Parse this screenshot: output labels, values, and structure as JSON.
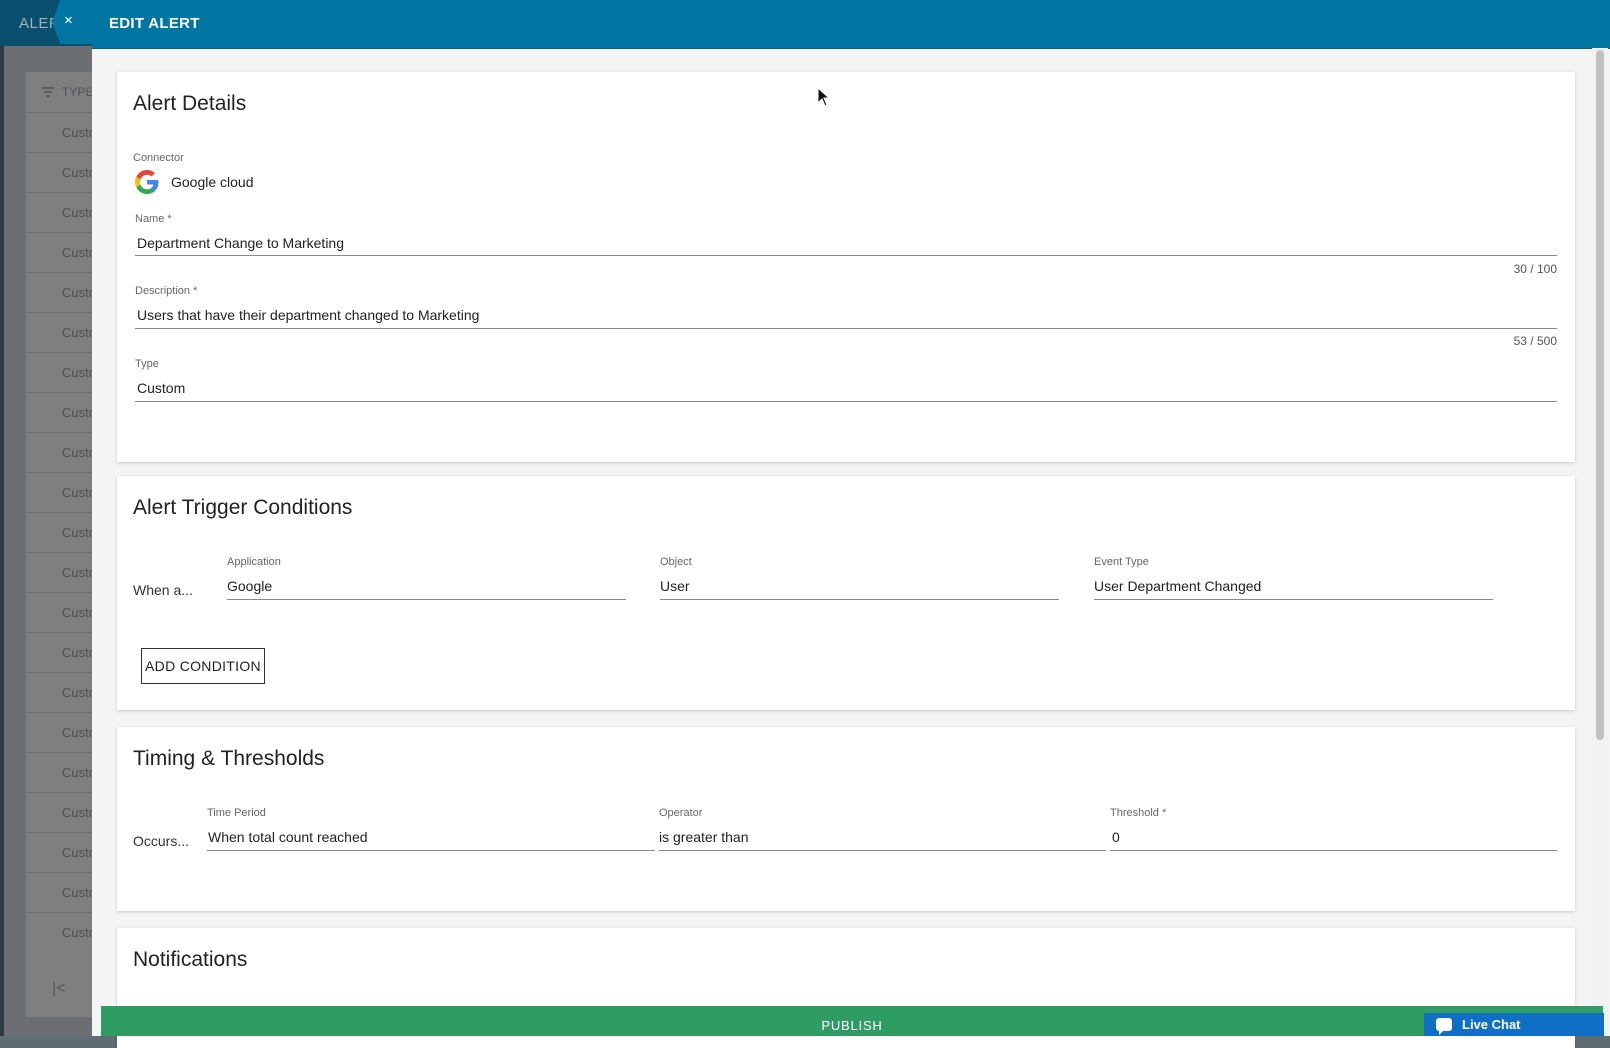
{
  "background": {
    "page_title": "ALER",
    "filter_header": "TYPE",
    "row_text": "Custo",
    "row_count": 21
  },
  "panel": {
    "title": "EDIT ALERT",
    "close_label": "×"
  },
  "alert_details": {
    "title": "Alert Details",
    "connector_label": "Connector",
    "connector_value": "Google cloud",
    "name_label": "Name *",
    "name_value": "Department Change to Marketing",
    "name_counter": "30 / 100",
    "description_label": "Description *",
    "description_value": "Users that have their department changed to Marketing",
    "description_counter": "53 / 500",
    "type_label": "Type",
    "type_value": "Custom"
  },
  "trigger": {
    "title": "Alert Trigger Conditions",
    "row_label": "When a...",
    "application_label": "Application",
    "application_value": "Google",
    "object_label": "Object",
    "object_value": "User",
    "event_label": "Event Type",
    "event_value": "User Department Changed",
    "add_condition": "ADD CONDITION"
  },
  "timing": {
    "title": "Timing & Thresholds",
    "row_label": "Occurs...",
    "period_label": "Time Period",
    "period_value": "When total count reached",
    "operator_label": "Operator",
    "operator_value": "is greater than",
    "threshold_label": "Threshold *",
    "threshold_value": "0"
  },
  "notifications": {
    "title": "Notifications"
  },
  "footer": {
    "publish": "PUBLISH",
    "live_chat": "Live Chat"
  },
  "colors": {
    "header": "#0276a2",
    "publish": "#2e9c63",
    "live_chat": "#0f6fc7"
  }
}
